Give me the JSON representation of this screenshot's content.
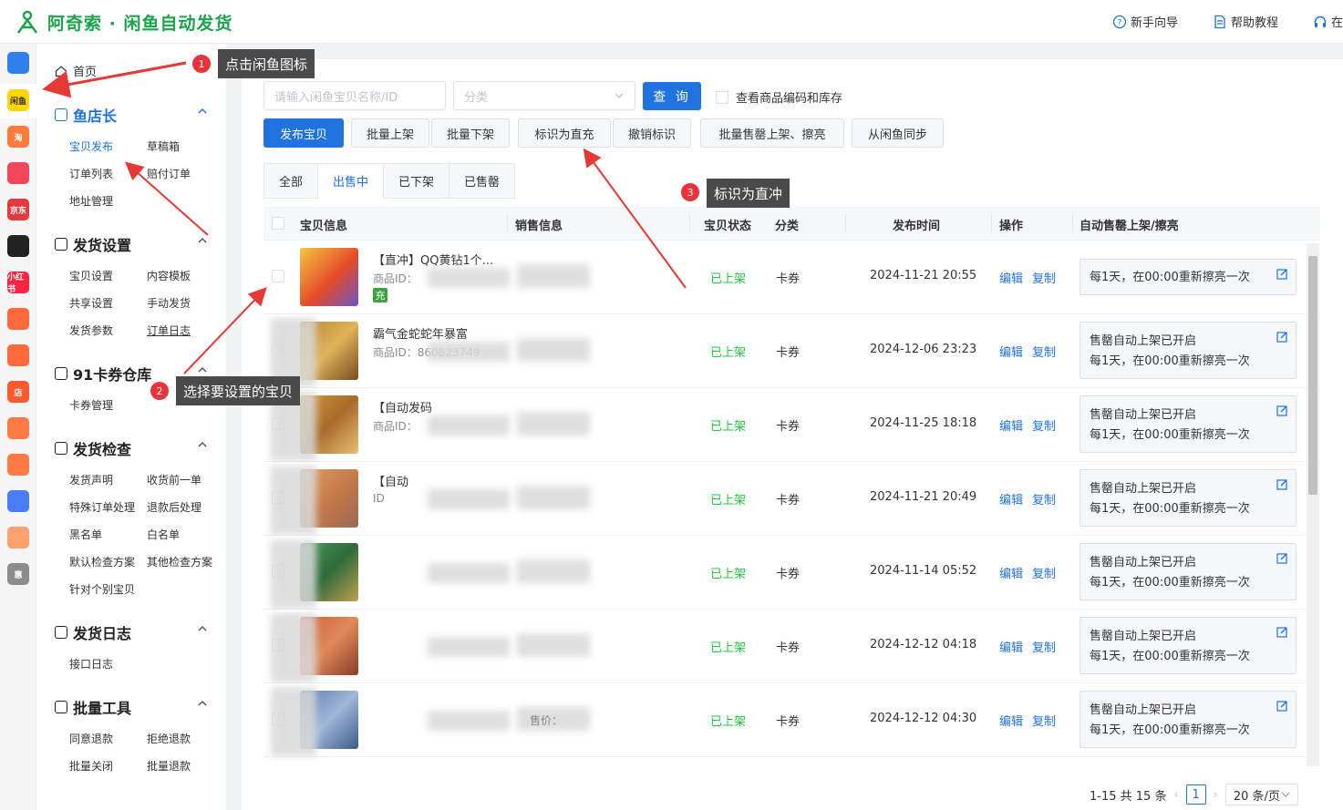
{
  "app": {
    "title": "阿奇索 · 闲鱼自动发货"
  },
  "top_actions": [
    {
      "label": "新手向导",
      "icon": "question-circle-icon"
    },
    {
      "label": "帮助教程",
      "icon": "document-icon"
    },
    {
      "label": "在",
      "icon": "headset-icon"
    }
  ],
  "rail_items": [
    {
      "name": "grid-apps-icon",
      "text": "",
      "color": "#2f80ed"
    },
    {
      "name": "xianyu-icon",
      "text": "闲鱼",
      "color": "#ffd600"
    },
    {
      "name": "taobao-icon",
      "text": "淘",
      "color": "#ff7a3d"
    },
    {
      "name": "pinduoduo-icon",
      "text": "",
      "color": "#f0455a"
    },
    {
      "name": "jingdong-icon",
      "text": "京东",
      "color": "#e3393c"
    },
    {
      "name": "douyin-icon",
      "text": "",
      "color": "#222222"
    },
    {
      "name": "xiaohongshu-icon",
      "text": "小红书",
      "color": "#ff2442"
    },
    {
      "name": "kuaishou-icon",
      "text": "",
      "color": "#ff6a3c"
    },
    {
      "name": "thumb-icon",
      "text": "",
      "color": "#ff6a3c"
    },
    {
      "name": "store-icon",
      "text": "店",
      "color": "#ff5a2e"
    },
    {
      "name": "gift-icon",
      "text": "",
      "color": "#ff7a45"
    },
    {
      "name": "bag-icon",
      "text": "",
      "color": "#ff7a45"
    },
    {
      "name": "link-icon",
      "text": "",
      "color": "#4a7cf7"
    },
    {
      "name": "shop-icon",
      "text": "",
      "color": "#ffa070"
    },
    {
      "name": "hui-icon",
      "text": "惠",
      "color": "#8c8c8c"
    }
  ],
  "sidebar": {
    "home": "首页",
    "sections": [
      {
        "title": "鱼店长",
        "active": true,
        "items": [
          [
            "宝贝发布",
            "草稿箱"
          ],
          [
            "订单列表",
            "赔付订单"
          ],
          [
            "地址管理",
            ""
          ]
        ]
      },
      {
        "title": "发货设置",
        "items": [
          [
            "宝贝设置",
            "内容模板"
          ],
          [
            "共享设置",
            "手动发货"
          ],
          [
            "发货参数",
            "订单日志"
          ]
        ]
      },
      {
        "title": "91卡券仓库",
        "items": [
          [
            "卡券管理",
            ""
          ]
        ]
      },
      {
        "title": "发货检查",
        "items": [
          [
            "发货声明",
            "收货前一单"
          ],
          [
            "特殊订单处理",
            "退款后处理"
          ],
          [
            "黑名单",
            "白名单"
          ],
          [
            "默认检查方案",
            "其他检查方案"
          ],
          [
            "针对个别宝贝",
            ""
          ]
        ]
      },
      {
        "title": "发货日志",
        "items": [
          [
            "接口日志",
            ""
          ]
        ]
      },
      {
        "title": "批量工具",
        "items": [
          [
            "同意退款",
            "拒绝退款"
          ],
          [
            "批量关闭",
            "批量退款"
          ]
        ]
      }
    ]
  },
  "search": {
    "placeholder": "请输入闲鱼宝贝名称/ID",
    "category_placeholder": "分类",
    "query_label": "查 询",
    "check_label": "查看商品编码和库存"
  },
  "toolbar": [
    "发布宝贝",
    "批量上架",
    "批量下架",
    "标识为直充",
    "撤销标识",
    "批量售罄上架、擦亮",
    "从闲鱼同步"
  ],
  "tabs": [
    "全部",
    "出售中",
    "已下架",
    "已售罄"
  ],
  "table": {
    "headers": [
      "宝贝信息",
      "销售信息",
      "宝贝状态",
      "分类",
      "发布时间",
      "操作",
      "自动售罄上架/擦亮"
    ],
    "rows": [
      {
        "title": "【直冲】QQ黄钻1个...",
        "id_label": "商品ID：",
        "status": "已上架",
        "category": "卡券",
        "time": "2024-11-21 20:55",
        "auto1": "每1天，在00:00重新擦亮一次",
        "auto2": "",
        "tag": "充"
      },
      {
        "title": "霸气金蛇蛇年暴富",
        "id_label": "商品ID：860823749",
        "status": "已上架",
        "category": "卡券",
        "time": "2024-12-06 23:23",
        "auto1": "售罄自动上架已开启",
        "auto2": "每1天，在00:00重新擦亮一次"
      },
      {
        "title": "【自动发码",
        "id_label": "商品ID：",
        "status": "已上架",
        "category": "卡券",
        "time": "2024-11-25 18:18",
        "auto1": "售罄自动上架已开启",
        "auto2": "每1天，在00:00重新擦亮一次"
      },
      {
        "title": "【自动",
        "id_label": "ID",
        "status": "已上架",
        "category": "卡券",
        "time": "2024-11-21 20:49",
        "auto1": "售罄自动上架已开启",
        "auto2": "每1天，在00:00重新擦亮一次"
      },
      {
        "title": "",
        "id_label": "",
        "status": "已上架",
        "category": "卡券",
        "time": "2024-11-14 05:52",
        "auto1": "售罄自动上架已开启",
        "auto2": "每1天，在00:00重新擦亮一次"
      },
      {
        "title": "",
        "id_label": "",
        "status": "已上架",
        "category": "卡券",
        "time": "2024-12-12 04:18",
        "auto1": "售罄自动上架已开启",
        "auto2": "每1天，在00:00重新擦亮一次"
      },
      {
        "title": "",
        "id_label": "",
        "status": "已上架",
        "category": "卡券",
        "time": "2024-12-12 04:30",
        "auto1": "售罄自动上架已开启",
        "auto2": "每1天，在00:00重新擦亮一次",
        "sale": "售价："
      }
    ],
    "op_edit": "编辑",
    "op_copy": "复制"
  },
  "pagination": {
    "summary": "1-15 共 15 条",
    "current": "1",
    "page_size": "20 条/页"
  },
  "annotations": [
    {
      "num": "1",
      "text": "点击闲鱼图标"
    },
    {
      "num": "2",
      "text": "选择要设置的宝贝"
    },
    {
      "num": "3",
      "text": "标识为直冲"
    }
  ],
  "colors": {
    "brand_green": "#1aa54a",
    "primary_blue": "#1f72e0",
    "status_green": "#1ec93c",
    "annotation_red": "#e8333a",
    "arrow_red": "#e53935"
  }
}
